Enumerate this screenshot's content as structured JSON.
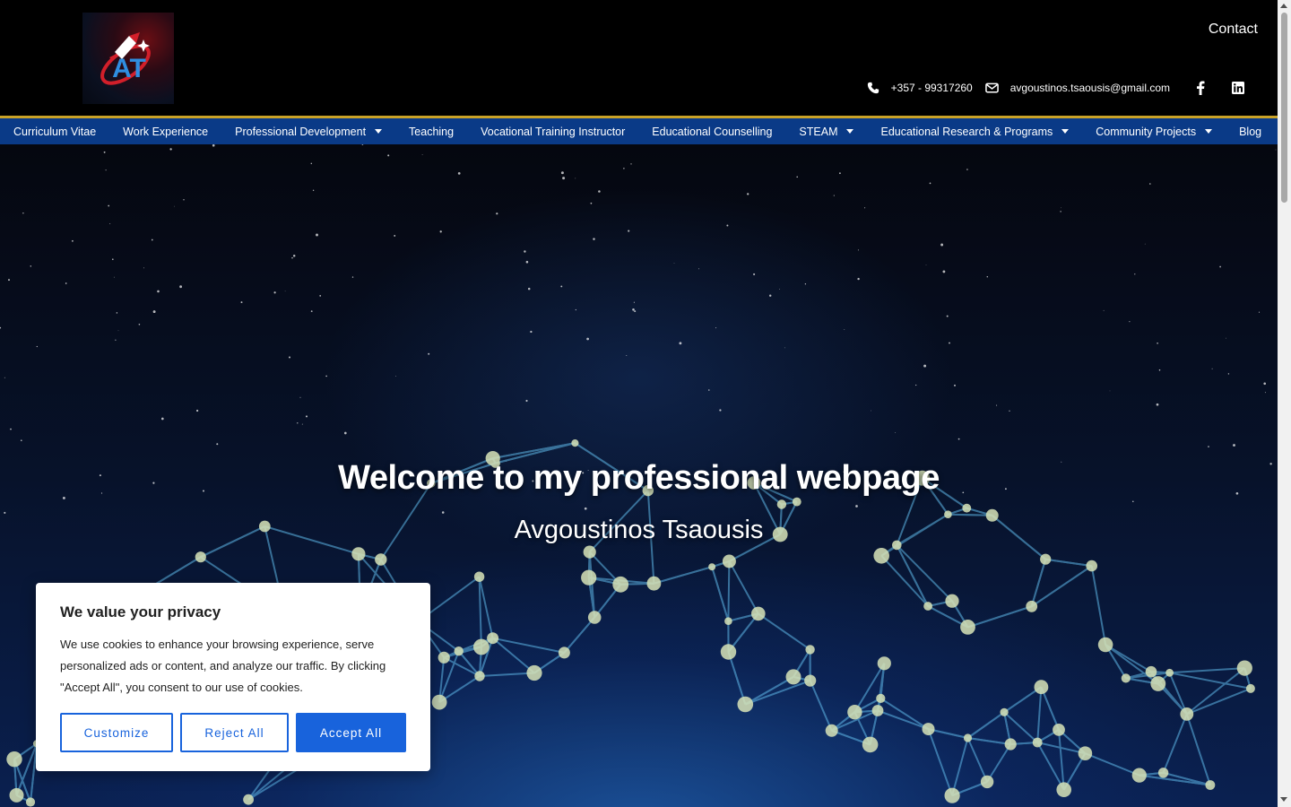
{
  "header": {
    "logo_text": "AT",
    "contact_label": "Contact",
    "phone": "+357 - 99317260",
    "email": "avgoustinos.tsaousis@gmail.com",
    "social_icons": [
      "facebook-icon",
      "linkedin-icon"
    ]
  },
  "nav": {
    "items": [
      {
        "label": "Curriculum Vitae",
        "dropdown": false
      },
      {
        "label": "Work Experience",
        "dropdown": false
      },
      {
        "label": "Professional Development",
        "dropdown": true
      },
      {
        "label": "Teaching",
        "dropdown": false
      },
      {
        "label": "Vocational Training Instructor",
        "dropdown": false
      },
      {
        "label": "Educational Counselling",
        "dropdown": false
      },
      {
        "label": "STEAM",
        "dropdown": true
      },
      {
        "label": "Educational Research & Programs",
        "dropdown": true
      },
      {
        "label": "Community Projects",
        "dropdown": true
      },
      {
        "label": "Blog",
        "dropdown": false
      }
    ]
  },
  "hero": {
    "title": "Welcome to my professional webpage",
    "subtitle": "Avgoustinos Tsaousis"
  },
  "cookie_banner": {
    "title": "We value your privacy",
    "text": "We use cookies to enhance your browsing experience, serve personalized ads or content, and analyze our traffic. By clicking \"Accept All\", you consent to our use of cookies.",
    "customize_label": "Customize",
    "reject_label": "Reject All",
    "accept_label": "Accept All"
  },
  "colors": {
    "nav_bg": "#0a3a87",
    "accent_line": "#c9a227",
    "button_blue": "#1863dc"
  }
}
